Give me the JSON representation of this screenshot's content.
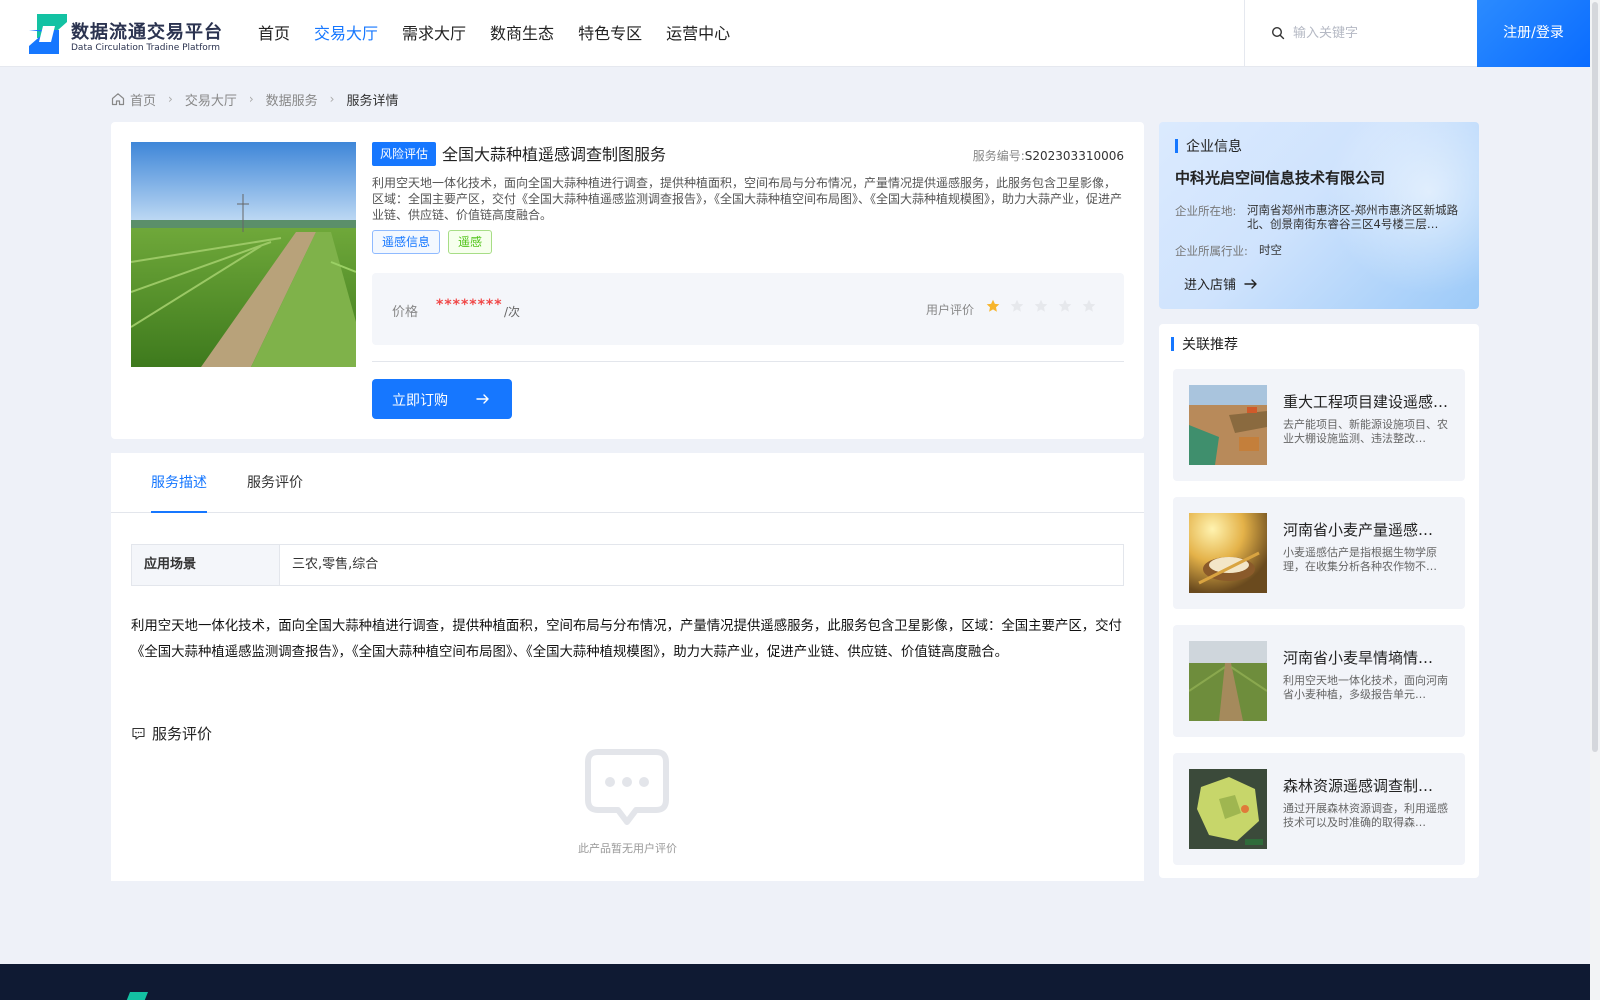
{
  "header": {
    "logo_title": "数据流通交易平台",
    "logo_subtitle": "Data Circulation Tradine Platform",
    "nav": [
      {
        "label": "首页",
        "active": false
      },
      {
        "label": "交易大厅",
        "active": true
      },
      {
        "label": "需求大厅",
        "active": false
      },
      {
        "label": "数商生态",
        "active": false
      },
      {
        "label": "特色专区",
        "active": false
      },
      {
        "label": "运营中心",
        "active": false
      }
    ],
    "search_placeholder": "输入关键字",
    "login_label": "注册/登录"
  },
  "breadcrumb": {
    "items": [
      "首页",
      "交易大厅",
      "数据服务",
      "服务详情"
    ]
  },
  "product": {
    "risk_tag": "风险评估",
    "title": "全国大蒜种植遥感调查制图服务",
    "service_no_label": "服务编号:",
    "service_no": "S202303310006",
    "description": "利用空天地一体化技术，面向全国大蒜种植进行调查，提供种植面积，空间布局与分布情况，产量情况提供遥感服务，此服务包含卫星影像，区域：全国主要产区，交付《全国大蒜种植遥感监测调查报告》，《全国大蒜种植空间布局图》、《全国大蒜种植规模图》，助力大蒜产业，促进产业链、供应链、价值链高度融合。",
    "tags": [
      {
        "label": "遥感信息",
        "color": "blue"
      },
      {
        "label": "遥感",
        "color": "green"
      }
    ],
    "price_label": "价格",
    "price_value": "********",
    "price_unit": "/次",
    "rating_label": "用户评价",
    "rating": 1,
    "rating_max": 5,
    "buy_label": "立即订购"
  },
  "detail": {
    "tabs": [
      {
        "label": "服务描述",
        "active": true
      },
      {
        "label": "服务评价",
        "active": false
      }
    ],
    "scene_key": "应用场景",
    "scene_value": "三农,零售,综合",
    "text": "利用空天地一体化技术，面向全国大蒜种植进行调查，提供种植面积，空间布局与分布情况，产量情况提供遥感服务，此服务包含卫星影像，区域：全国主要产区，交付《全国大蒜种植遥感监测调查报告》，《全国大蒜种植空间布局图》、《全国大蒜种植规模图》，助力大蒜产业，促进产业链、供应链、价值链高度融合。",
    "review_title": "服务评价",
    "empty_text": "此产品暂无用户评价"
  },
  "company": {
    "section_title": "企业信息",
    "name": "中科光启空间信息技术有限公司",
    "location_label": "企业所在地:",
    "location": "河南省郑州市惠济区-郑州市惠济区新城路北、创景南街东睿谷三区4号楼三层…",
    "industry_label": "企业所属行业:",
    "industry": "时空",
    "enter_label": "进入店铺"
  },
  "recommend": {
    "section_title": "关联推荐",
    "items": [
      {
        "title": "重大工程项目建设遥感…",
        "desc": "去产能项目、新能源设施项目、农业大棚设施监测、违法整改…",
        "image": "construction-site"
      },
      {
        "title": "河南省小麦产量遥感…",
        "desc": "小麦遥感估产是指根据生物学原理，在收集分析各种农作物不…",
        "image": "wheat-grain"
      },
      {
        "title": "河南省小麦旱情墒情…",
        "desc": "利用空天地一体化技术，面向河南省小麦种植，多级报告单元…",
        "image": "wheat-field"
      },
      {
        "title": "森林资源遥感调查制…",
        "desc": "通过开展森林资源调查，利用遥感技术可以及时准确的取得森…",
        "image": "forest-map"
      }
    ]
  },
  "colors": {
    "accent": "#1677ff",
    "price": "#f04848",
    "star_active": "#f7b52c",
    "star_inactive": "#e6e8ec",
    "tag_green": "#52c41a",
    "footer": "#0f1a33"
  }
}
